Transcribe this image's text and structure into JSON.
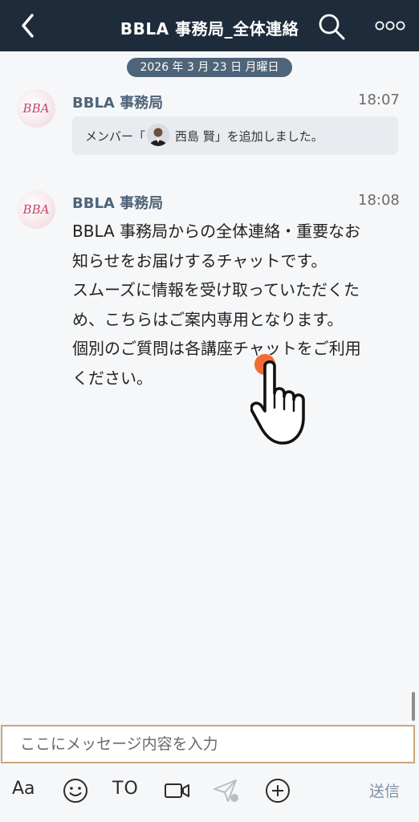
{
  "header": {
    "title": "BBLA 事務局_全体連絡",
    "back_icon": "chevron-left-icon",
    "search_icon": "search-icon",
    "more_icon": "more-horizontal-icon"
  },
  "date_separator": "2026 年 3 月 23 日 月曜日",
  "messages": [
    {
      "sender": "BBLA 事務局",
      "time": "18:07",
      "avatar_label": "BBA",
      "system_prefix": "メンバー「",
      "system_member": "西島 賢」を追加しました。"
    },
    {
      "sender": "BBLA 事務局",
      "time": "18:08",
      "avatar_label": "BBA",
      "text": "BBLA 事務局からの全体連絡・重要なお\n知らせをお届けするチャットです。\nスムーズに情報を受け取っていただくた\nめ、こちらはご案内専用となります。\n個別のご質問は各講座チャットをご利用\nください。"
    }
  ],
  "composer": {
    "placeholder": "ここにメッセージ内容を入力"
  },
  "toolbar": {
    "text_style_label": "Aa",
    "to_label": "TO",
    "send_label": "送信",
    "icons": [
      "emoji-icon",
      "video-icon",
      "send-arrow-icon",
      "plus-icon"
    ]
  },
  "colors": {
    "header_bg": "#1e2b3a",
    "date_pill_bg": "#4e6478",
    "sender_color": "#4e6478",
    "accent_orange": "#f26b35",
    "input_border": "#c8a87a"
  }
}
